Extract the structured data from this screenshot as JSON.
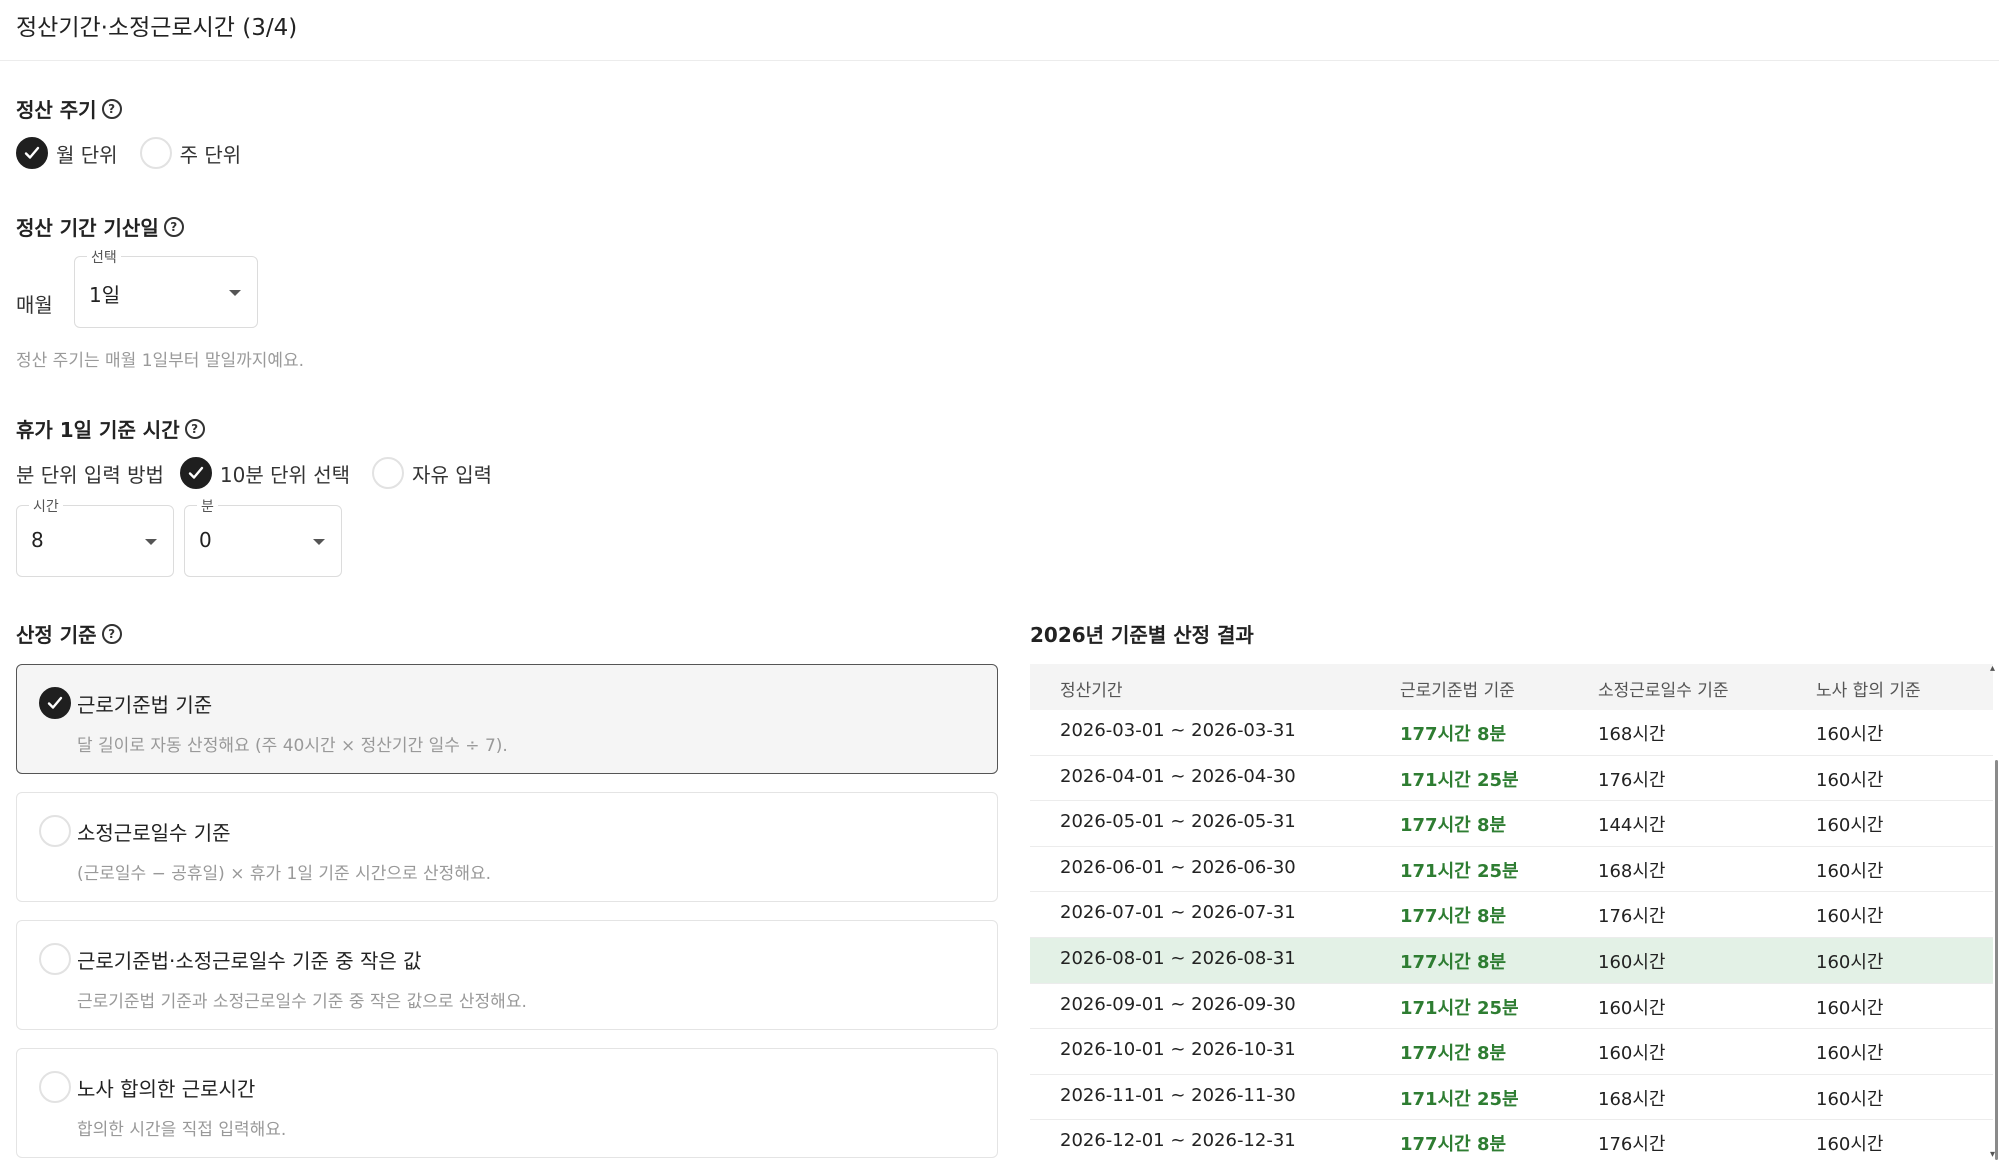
{
  "header": {
    "title": "정산기간·소정근로시간 (3/4)"
  },
  "settlement_cycle": {
    "title": "정산 주기",
    "options": [
      {
        "label": "월 단위",
        "checked": true
      },
      {
        "label": "주 단위",
        "checked": false
      }
    ]
  },
  "start_day": {
    "title": "정산 기간 기산일",
    "prefix": "매월",
    "select_legend": "선택",
    "select_value": "1일",
    "hint": "정산 주기는 매월 1일부터 말일까지예요."
  },
  "leave_hours": {
    "title": "휴가 1일 기준 시간",
    "input_method_label": "분 단위 입력 방법",
    "options": [
      {
        "label": "10분 단위 선택",
        "checked": true
      },
      {
        "label": "자유 입력",
        "checked": false
      }
    ],
    "hour_select": {
      "legend": "시간",
      "value": "8"
    },
    "minute_select": {
      "legend": "분",
      "value": "0"
    }
  },
  "calc_basis": {
    "title": "산정 기준",
    "options": [
      {
        "title": "근로기준법 기준",
        "desc": "달 길이로 자동 산정해요 (주 40시간 × 정산기간 일수 ÷ 7).",
        "checked": true
      },
      {
        "title": "소정근로일수 기준",
        "desc": "(근로일수 − 공휴일) × 휴가 1일 기준 시간으로 산정해요.",
        "checked": false
      },
      {
        "title": "근로기준법·소정근로일수 기준 중 작은 값",
        "desc": "근로기준법 기준과 소정근로일수 기준 중 작은 값으로 산정해요.",
        "checked": false
      },
      {
        "title": "노사 합의한 근로시간",
        "desc": "합의한 시간을 직접 입력해요.",
        "checked": false
      }
    ]
  },
  "results": {
    "title": "2026년 기준별 산정 결과",
    "columns": [
      "정산기간",
      "근로기준법 기준",
      "소정근로일수 기준",
      "노사 합의 기준"
    ],
    "rows": [
      {
        "period": "2026-03-01 ~ 2026-03-31",
        "labor_law": "177시간 8분",
        "workdays": "168시간",
        "agreement": "160시간",
        "highlight": false
      },
      {
        "period": "2026-04-01 ~ 2026-04-30",
        "labor_law": "171시간 25분",
        "workdays": "176시간",
        "agreement": "160시간",
        "highlight": false
      },
      {
        "period": "2026-05-01 ~ 2026-05-31",
        "labor_law": "177시간 8분",
        "workdays": "144시간",
        "agreement": "160시간",
        "highlight": false
      },
      {
        "period": "2026-06-01 ~ 2026-06-30",
        "labor_law": "171시간 25분",
        "workdays": "168시간",
        "agreement": "160시간",
        "highlight": false
      },
      {
        "period": "2026-07-01 ~ 2026-07-31",
        "labor_law": "177시간 8분",
        "workdays": "176시간",
        "agreement": "160시간",
        "highlight": false
      },
      {
        "period": "2026-08-01 ~ 2026-08-31",
        "labor_law": "177시간 8분",
        "workdays": "160시간",
        "agreement": "160시간",
        "highlight": true
      },
      {
        "period": "2026-09-01 ~ 2026-09-30",
        "labor_law": "171시간 25분",
        "workdays": "160시간",
        "agreement": "160시간",
        "highlight": false
      },
      {
        "period": "2026-10-01 ~ 2026-10-31",
        "labor_law": "177시간 8분",
        "workdays": "160시간",
        "agreement": "160시간",
        "highlight": false
      },
      {
        "period": "2026-11-01 ~ 2026-11-30",
        "labor_law": "171시간 25분",
        "workdays": "168시간",
        "agreement": "160시간",
        "highlight": false
      },
      {
        "period": "2026-12-01 ~ 2026-12-31",
        "labor_law": "177시간 8분",
        "workdays": "176시간",
        "agreement": "160시간",
        "highlight": false
      }
    ]
  },
  "icons": {
    "help": "help-circle-icon",
    "check": "check-icon",
    "caret": "caret-down-icon"
  },
  "colors": {
    "accent_green": "#2e7d32",
    "highlight_row": "#e3f1e6",
    "checked_radio": "#1f1f1f"
  }
}
